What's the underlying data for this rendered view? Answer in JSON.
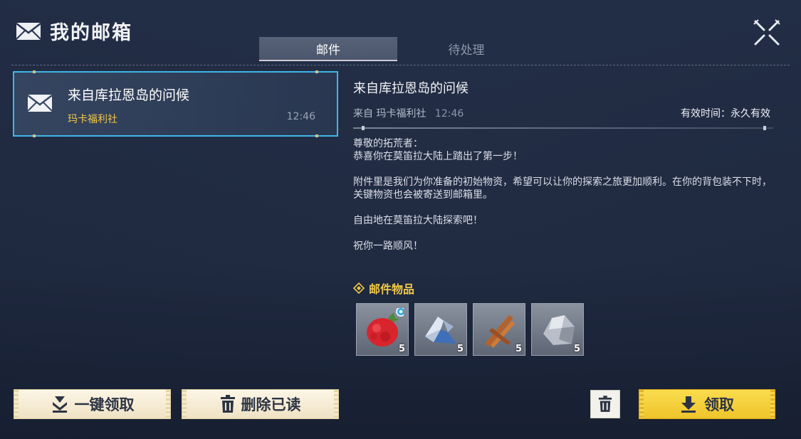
{
  "window": {
    "title": "我的邮箱"
  },
  "tabs": [
    {
      "label": "邮件",
      "active": true
    },
    {
      "label": "待处理",
      "active": false
    }
  ],
  "mail_list": [
    {
      "title": "来自库拉恩岛的问候",
      "sender": "玛卡福利社",
      "time": "12:46",
      "selected": true
    }
  ],
  "detail": {
    "title": "来自库拉恩岛的问候",
    "from_label": "来自 玛卡福利社",
    "time": "12:46",
    "validity": "有效时间：永久有效",
    "body": {
      "greeting": "尊敬的拓荒者：",
      "line1": "恭喜你在莫笛拉大陆上踏出了第一步！",
      "para2": "附件里是我们为你准备的初始物资，希望可以让你的探索之旅更加顺利。在你的背包装不下时，关键物资也会被寄送到邮箱里。",
      "para3": "自由地在莫笛拉大陆探索吧！",
      "para4": "祝你一路顺风！"
    }
  },
  "attachments": {
    "header": "邮件物品",
    "items": [
      {
        "icon": "berry-icon",
        "qty": "5"
      },
      {
        "icon": "crystal-ore-icon",
        "qty": "5"
      },
      {
        "icon": "wood-sticks-icon",
        "qty": "5"
      },
      {
        "icon": "stone-icon",
        "qty": "5"
      }
    ]
  },
  "buttons": {
    "claim_all": "一键领取",
    "delete_read": "删除已读",
    "claim": "领取"
  },
  "colors": {
    "accent_blue": "#3fb6e8",
    "gold": "#f0c84a",
    "claim_yellow": "#f9dc4e"
  }
}
